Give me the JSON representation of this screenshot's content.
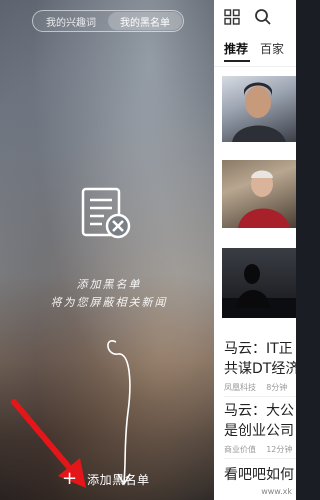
{
  "drawer": {
    "tabs": [
      {
        "label": "我的兴趣词",
        "active": false
      },
      {
        "label": "我的黑名单",
        "active": true
      }
    ],
    "hint_line1": "添加黑名单",
    "hint_line2": "将为您屏蔽相关新闻",
    "add_button": {
      "icon": "plus-icon",
      "label": "添加黑名单"
    }
  },
  "panel": {
    "header_icons": [
      "grid-icon",
      "search-icon"
    ],
    "tabs": [
      {
        "label": "推荐",
        "active": true
      },
      {
        "label": "百家",
        "active": false
      }
    ],
    "articles": [
      {
        "headline_line1": "马云：IT正",
        "headline_line2": "共谋DT经济",
        "source": "凤凰科技",
        "time": "8分钟"
      },
      {
        "headline_line1": "马云：大公",
        "headline_line2": "是创业公司",
        "source": "商业价值",
        "time": "12分钟"
      },
      {
        "headline_line1": "看吧吧如何"
      }
    ]
  },
  "watermark": "www.xk"
}
